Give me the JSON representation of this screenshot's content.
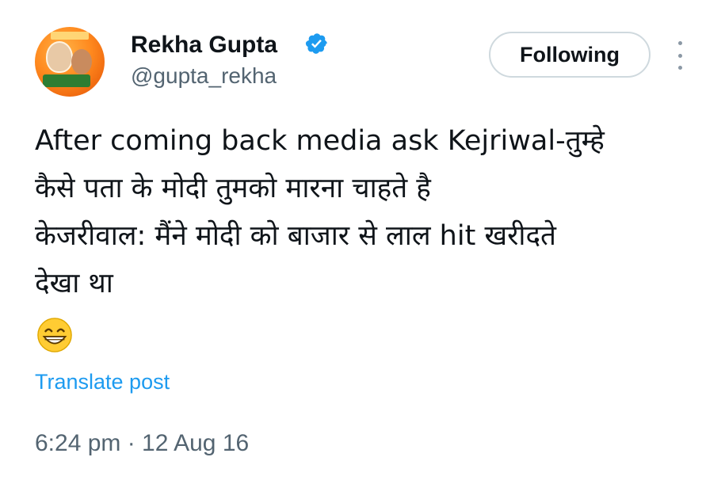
{
  "author": {
    "name": "Rekha Gupta",
    "handle": "@gupta_rekha",
    "verified_icon": "verified-badge-icon",
    "avatar_icon": "profile-avatar"
  },
  "actions": {
    "follow_label": "Following",
    "more_icon": "more-options-icon"
  },
  "post": {
    "lines": [
      "After coming back media ask Kejriwal-तुम्हे",
      "कैसे पता के मोदी तुमको मारना चाहते है",
      "केजरीवाल: मैंने मोदी को बाजार से लाल hit खरीदते",
      "देखा था"
    ],
    "emoji": "grinning-face-with-smiling-eyes-emoji"
  },
  "translate_label": "Translate post",
  "timestamp": "6:24 pm · 12 Aug 16",
  "colors": {
    "link": "#1d9bf0",
    "secondary_text": "#536471",
    "verified": "#1d9bf0"
  }
}
